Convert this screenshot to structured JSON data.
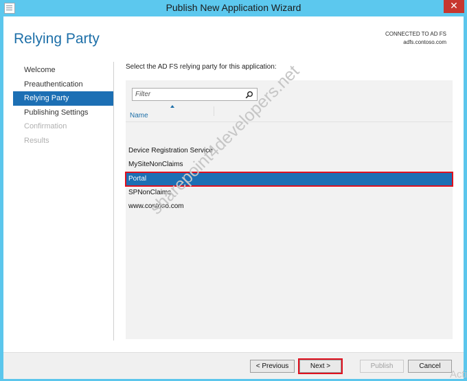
{
  "window": {
    "title": "Publish New Application Wizard",
    "close_glyph": "✕"
  },
  "page": {
    "title": "Relying Party",
    "connection_label": "CONNECTED TO AD FS",
    "connection_server": "adfs.contoso.com",
    "instruction": "Select the AD FS relying party for this application:"
  },
  "nav": {
    "items": [
      {
        "label": "Welcome",
        "state": "normal"
      },
      {
        "label": "Preauthentication",
        "state": "normal"
      },
      {
        "label": "Relying Party",
        "state": "selected"
      },
      {
        "label": "Publishing Settings",
        "state": "normal"
      },
      {
        "label": "Confirmation",
        "state": "disabled"
      },
      {
        "label": "Results",
        "state": "disabled"
      }
    ]
  },
  "list": {
    "filter_placeholder": "Filter",
    "filter_value": "",
    "column_header": "Name",
    "sort": "ascending",
    "rows": [
      {
        "name": "Device Registration Service",
        "selected": false
      },
      {
        "name": "MySiteNonClaims",
        "selected": false
      },
      {
        "name": "Portal",
        "selected": true
      },
      {
        "name": "SPNonClaims",
        "selected": false
      },
      {
        "name": "www.contoso.com",
        "selected": false
      }
    ]
  },
  "buttons": {
    "previous": "< Previous",
    "next": "Next >",
    "publish": "Publish",
    "cancel": "Cancel"
  },
  "watermark": "sharepoint4developers.net",
  "activation_text": "Acti",
  "colors": {
    "titlebar": "#5cc8ee",
    "accent": "#1c6fb4",
    "title_text": "#1d6fa8",
    "highlight_border": "#e0101e"
  },
  "icons": {
    "app": "wizard-app-icon",
    "close": "close-icon",
    "search": "search-icon",
    "sort": "sort-ascending-icon"
  }
}
